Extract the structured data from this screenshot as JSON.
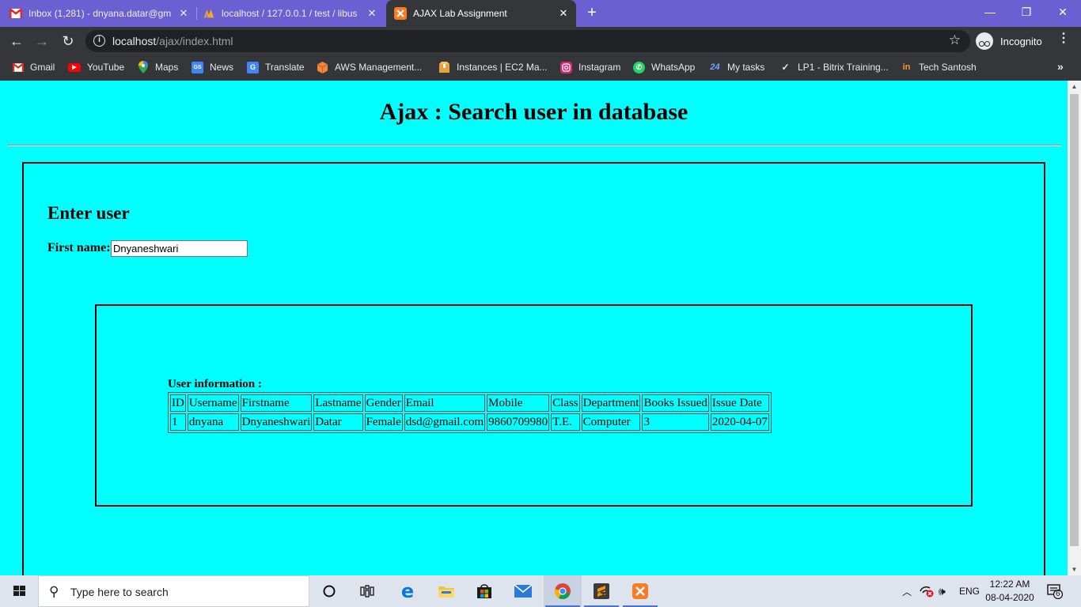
{
  "browser": {
    "tabs": [
      {
        "title": "Inbox (1,281) - dnyana.datar@gm",
        "icon": "gmail-icon",
        "active": false
      },
      {
        "title": "localhost / 127.0.0.1 / test / libus",
        "icon": "phpmyadmin-icon",
        "active": false
      },
      {
        "title": "AJAX Lab Assignment",
        "icon": "xampp-icon",
        "active": true
      }
    ],
    "new_tab": "+",
    "address": {
      "host": "localhost",
      "path": "/ajax/index.html"
    },
    "profile_label": "Incognito",
    "bookmarks": [
      {
        "label": "Gmail",
        "icon": "gmail-icon"
      },
      {
        "label": "YouTube",
        "icon": "youtube-icon"
      },
      {
        "label": "Maps",
        "icon": "maps-icon"
      },
      {
        "label": "News",
        "icon": "news-icon"
      },
      {
        "label": "Translate",
        "icon": "translate-icon"
      },
      {
        "label": "AWS Management...",
        "icon": "aws-icon"
      },
      {
        "label": "Instances | EC2 Ma...",
        "icon": "ec2-icon"
      },
      {
        "label": "Instagram",
        "icon": "instagram-icon"
      },
      {
        "label": "WhatsApp",
        "icon": "whatsapp-icon"
      },
      {
        "label": "My tasks",
        "icon": "tasks-icon"
      },
      {
        "label": "LP1 - Bitrix Training...",
        "icon": "bitrix-icon"
      },
      {
        "label": "Tech Santosh",
        "icon": "techsantosh-icon"
      }
    ]
  },
  "page": {
    "heading": "Ajax : Search user in database",
    "form_heading": "Enter user",
    "first_name_label": "First name:",
    "first_name_value": "Dnyaneshwari",
    "result_label": "User information :",
    "table": {
      "headers": [
        "ID",
        "Username",
        "Firstname",
        "Lastname",
        "Gender",
        "Email",
        "Mobile",
        "Class",
        "Department",
        "Books Issued",
        "Issue Date"
      ],
      "rows": [
        [
          "1",
          "dnyana",
          "Dnyaneshwari",
          "Datar",
          "Female",
          "dsd@gmail.com",
          "9860709980",
          "T.E.",
          "Computer",
          "3",
          "2020-04-07"
        ]
      ]
    },
    "background_color": "#00ffff"
  },
  "taskbar": {
    "search_placeholder": "Type here to search",
    "language": "ENG",
    "time": "12:22 AM",
    "date": "08-04-2020",
    "notification_count": "6"
  }
}
